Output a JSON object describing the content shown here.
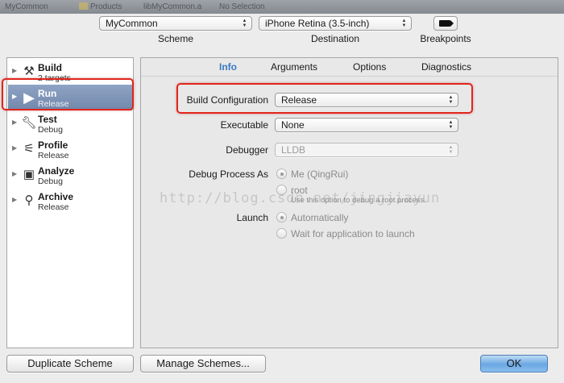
{
  "window": {
    "breadcrumbs": [
      "MyCommon",
      "Products",
      "libMyCommon.a",
      "No Selection"
    ]
  },
  "toolbar": {
    "scheme": {
      "value": "MyCommon",
      "caption": "Scheme"
    },
    "destination": {
      "value": "iPhone Retina (3.5-inch)",
      "caption": "Destination"
    },
    "breakpoints": {
      "caption": "Breakpoints",
      "icon": "breakpoint-icon"
    }
  },
  "sidebar": {
    "items": [
      {
        "name": "Build",
        "sub": "2 targets",
        "icon": "hammer-icon",
        "selected": false
      },
      {
        "name": "Run",
        "sub": "Release",
        "icon": "play-icon",
        "selected": true
      },
      {
        "name": "Test",
        "sub": "Debug",
        "icon": "wrench-icon",
        "selected": false
      },
      {
        "name": "Profile",
        "sub": "Release",
        "icon": "profile-icon",
        "selected": false
      },
      {
        "name": "Analyze",
        "sub": "Debug",
        "icon": "analyze-icon",
        "selected": false
      },
      {
        "name": "Archive",
        "sub": "Release",
        "icon": "archive-icon",
        "selected": false
      }
    ]
  },
  "tabs": [
    {
      "label": "Info",
      "active": true
    },
    {
      "label": "Arguments",
      "active": false
    },
    {
      "label": "Options",
      "active": false
    },
    {
      "label": "Diagnostics",
      "active": false
    }
  ],
  "info": {
    "build_configuration": {
      "label": "Build Configuration",
      "value": "Release"
    },
    "executable": {
      "label": "Executable",
      "value": "None"
    },
    "debugger": {
      "label": "Debugger",
      "value": "LLDB"
    },
    "debug_process": {
      "label": "Debug Process As",
      "options": [
        "Me (QingRui)",
        "root"
      ],
      "hint": "Use this option to debug a root process."
    },
    "launch": {
      "label": "Launch",
      "options": [
        "Automatically",
        "Wait for application to launch"
      ]
    }
  },
  "watermark": "http://blog.csdn.net/jingjiayun",
  "footer": {
    "duplicate": "Duplicate Scheme",
    "manage": "Manage Schemes...",
    "ok": "OK"
  },
  "colors": {
    "highlight_box": "#e1251b",
    "selection": "#7d93b6",
    "active_tab": "#3a7bc0",
    "default_button": "#6aa7e3"
  }
}
